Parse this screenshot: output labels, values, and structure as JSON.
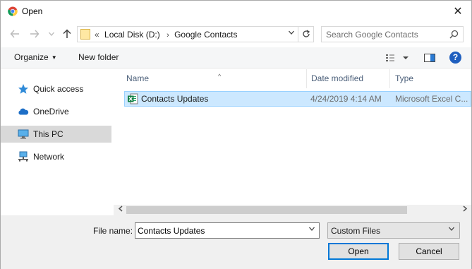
{
  "window": {
    "title": "Open",
    "app_icon": "chrome-icon"
  },
  "titlebar": {
    "close_label": "✕"
  },
  "navigation": {
    "back_icon": "arrow-left-icon",
    "forward_icon": "arrow-right-icon",
    "recent_icon": "chevron-down-icon",
    "up_icon": "arrow-up-icon"
  },
  "address": {
    "overflow": "«",
    "breadcrumbs": [
      "Local Disk (D:)",
      "Google Contacts"
    ],
    "separator": "›"
  },
  "search": {
    "placeholder": "Search Google Contacts"
  },
  "commandbar": {
    "organize": "Organize",
    "new_folder": "New folder",
    "help": "?"
  },
  "sidebar": {
    "items": [
      {
        "label": "Quick access",
        "icon": "star-icon"
      },
      {
        "label": "OneDrive",
        "icon": "cloud-icon"
      },
      {
        "label": "This PC",
        "icon": "computer-icon",
        "selected": true
      },
      {
        "label": "Network",
        "icon": "network-icon"
      }
    ]
  },
  "filelist": {
    "columns": [
      "Name",
      "Date modified",
      "Type"
    ],
    "rows": [
      {
        "name": "Contacts Updates",
        "date": "4/24/2019 4:14 AM",
        "type": "Microsoft Excel C...",
        "icon": "excel-file-icon",
        "selected": true
      }
    ]
  },
  "bottom": {
    "file_name_label": "File name:",
    "file_name_value": "Contacts Updates",
    "file_type": "Custom Files",
    "open_button": "Open",
    "cancel_button": "Cancel"
  },
  "colors": {
    "selection_bg": "#cce8ff",
    "selection_border": "#99d1ff",
    "accent": "#0078d7",
    "header_text": "#4c607a"
  }
}
